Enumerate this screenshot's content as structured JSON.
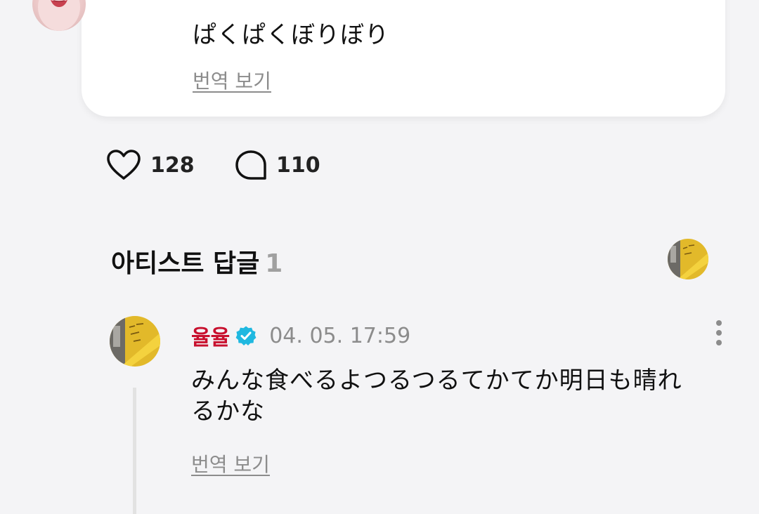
{
  "post": {
    "text": "ぱくぱくぼりぼり",
    "translate_label": "번역 보기"
  },
  "stats": {
    "likes": "128",
    "comments": "110"
  },
  "artist_replies": {
    "title": "아티스트 답글",
    "count": "1"
  },
  "comment": {
    "author": "율율",
    "timestamp": "04. 05. 17:59",
    "text": "みんな食べるよつるつるてかてか明日も晴れるかな",
    "translate_label": "번역 보기"
  },
  "icons": {
    "like": "heart-outline-icon",
    "comment": "speech-bubble-icon",
    "verified": "verified-badge-icon",
    "more": "more-vertical-icon"
  },
  "colors": {
    "author": "#c8102e",
    "verified": "#1fb8e0",
    "muted": "#8c8c8c",
    "background": "#f4f4f6"
  }
}
